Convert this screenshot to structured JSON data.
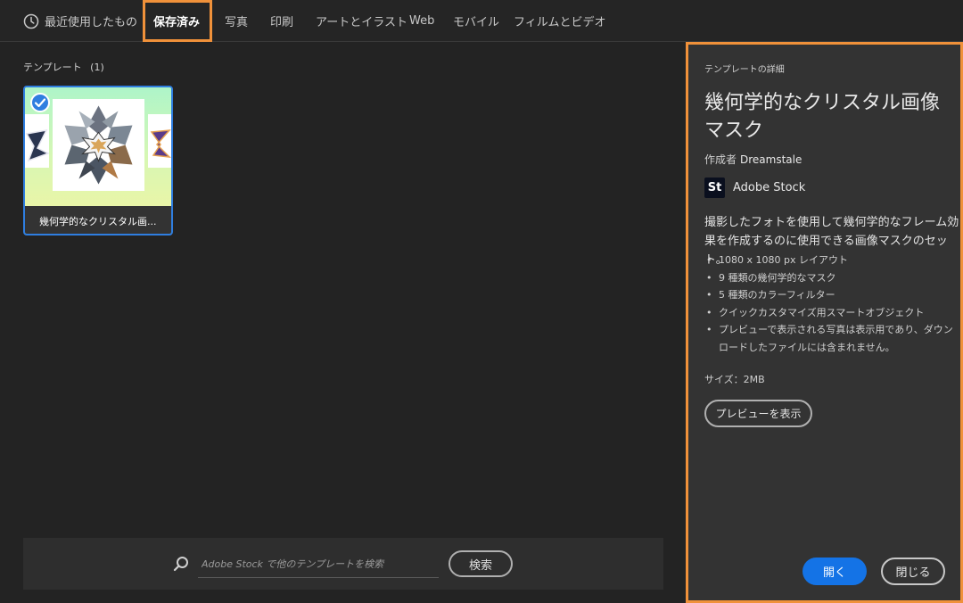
{
  "tabs": {
    "recent": "最近使用したもの",
    "saved": "保存済み",
    "photo": "写真",
    "print": "印刷",
    "art": "アートとイラスト",
    "web": "Web",
    "mobile": "モバイル",
    "film": "フィルムとビデオ"
  },
  "templates": {
    "section_label": "テンプレート",
    "count": "(1)",
    "items": [
      {
        "caption": "幾何学的なクリスタル画..."
      }
    ]
  },
  "search": {
    "placeholder": "Adobe Stock で他のテンプレートを検索",
    "button": "検索"
  },
  "details": {
    "label": "テンプレートの詳細",
    "title": "幾何学的なクリスタル画像マスク",
    "author_label": "作成者",
    "author": "Dreamstale",
    "source": "Adobe Stock",
    "source_logo": "St",
    "description": "撮影したフォトを使用して幾何学的なフレーム効果を作成するのに使用できる画像マスクのセット。",
    "bullets": [
      "1080 x 1080 px レイアウト",
      "9 種類の幾何学的なマスク",
      "5 種類のカラーフィルター",
      "クイックカスタマイズ用スマートオブジェクト",
      "プレビューで表示される写真は表示用であり、ダウンロードしたファイルには含まれません。"
    ],
    "size": "サイズ：2MB",
    "preview_button": "プレビューを表示",
    "open_button": "開く",
    "close_button": "閉じる"
  },
  "colors": {
    "accent": "#f0913a",
    "primary": "#1473e6",
    "selection": "#2f7ee0",
    "background": "#232323",
    "panel": "#333333"
  }
}
